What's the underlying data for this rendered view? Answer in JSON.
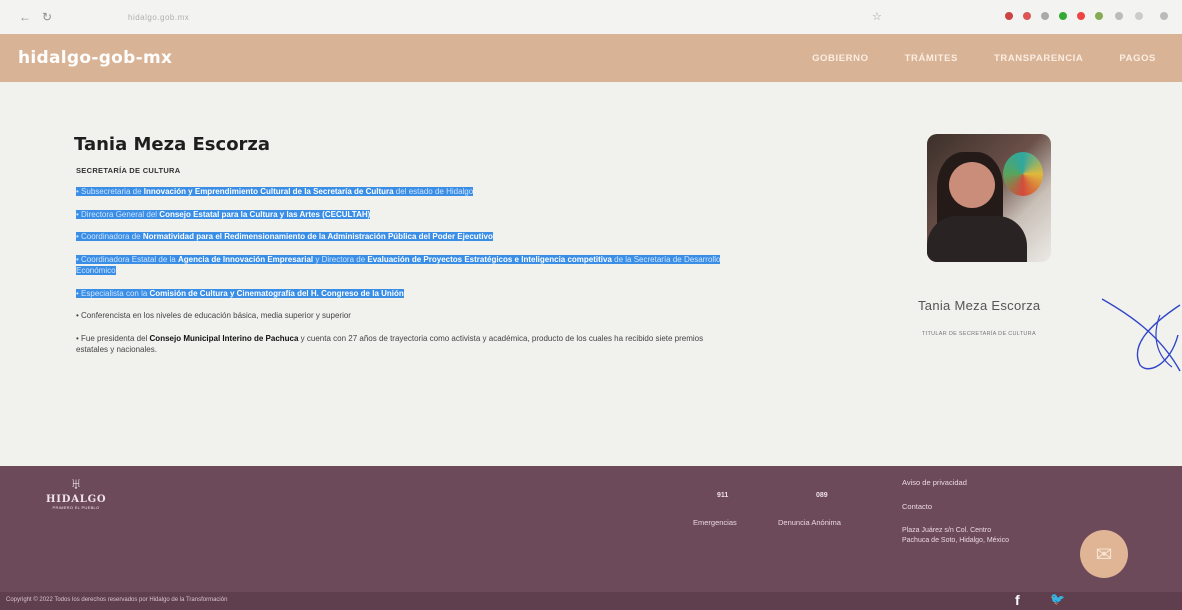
{
  "browser": {
    "url": "hidalgo.gob.mx"
  },
  "header": {
    "logo": "hidalgo-gob-mx",
    "nav": [
      "GOBIERNO",
      "TRÁMITES",
      "TRANSPARENCIA",
      "PAGOS"
    ]
  },
  "profile": {
    "name": "Tania Meza Escorza",
    "department": "SECRETARÍA DE CULTURA",
    "bullets": [
      {
        "highlighted": true,
        "parts": [
          "Subsecretaria de ",
          "Innovación y Emprendimiento Cultural de la Secretaría de Cultura",
          " del estado de Hidalgo"
        ]
      },
      {
        "highlighted": true,
        "parts": [
          "Directora General del ",
          "Consejo Estatal para la Cultura y las Artes (CECULTAH)",
          ""
        ]
      },
      {
        "highlighted": true,
        "parts": [
          "Coordinadora de ",
          "Normatividad para el Redimensionamiento de la Administración Pública del Poder Ejecutivo",
          ""
        ]
      },
      {
        "highlighted": true,
        "parts": [
          "Coordinadora Estatal de la ",
          "Agencia de Innovación Empresarial",
          " y Directora de ",
          "Evaluación de Proyectos Estratégicos e Inteligencia competitiva",
          " de la Secretaría de Desarrollo Económico"
        ]
      },
      {
        "highlighted": true,
        "parts": [
          "Especialista con la ",
          "Comisión de Cultura y Cinematografía del H. Congreso de la Unión",
          ""
        ]
      },
      {
        "highlighted": false,
        "parts": [
          "Conferencista en los niveles de educación básica, media superior y superior",
          "",
          ""
        ]
      },
      {
        "highlighted": false,
        "parts": [
          "Fue presidenta del ",
          "Consejo Municipal Interino de Pachuca",
          " y cuenta con 27 años de trayectoria como activista y académica, producto de los cuales ha recibido siete premios estatales y nacionales."
        ]
      }
    ],
    "side_name": "Tania Meza Escorza",
    "side_title": "TITULAR DE SECRETARÍA DE CULTURA"
  },
  "footer": {
    "logo_word": "HIDALGO",
    "logo_sub": "PRIMERO EL PUEBLO",
    "phone1": {
      "number": "911",
      "label": "Emergencias"
    },
    "phone2": {
      "number": "089",
      "label": "Denuncia Anónima"
    },
    "links": [
      "Aviso de privacidad",
      "Contacto"
    ],
    "address": [
      "Plaza Juárez s/n Col. Centro",
      "Pachuca de Soto, Hidalgo, México"
    ],
    "copyright": "Copyright © 2022 Todos los derechos reservados por Hidalgo de la Transformación",
    "social": {
      "facebook": "f",
      "twitter": "🐦"
    }
  },
  "colors": {
    "header": "#d9b395",
    "footer": "#6d4a5a",
    "highlight": "#3a8ee6"
  }
}
